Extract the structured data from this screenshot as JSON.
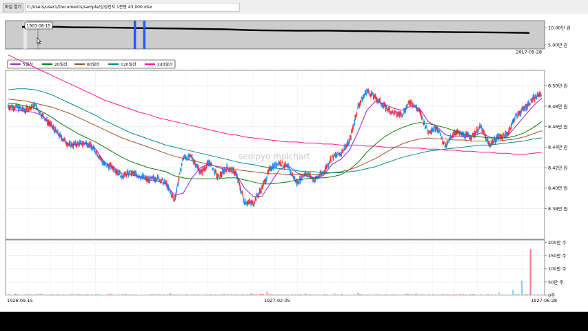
{
  "toolbar": {
    "open_label": "파일 열기",
    "file_path": "C:/Users/user1/Documents/sample/삼성전자 1분봉 43,000.xlsx"
  },
  "watermark": "seolpyo mplchart",
  "colors": {
    "up": "#fe3032",
    "down": "#1e90ff",
    "ma5": "#9932cc",
    "ma20": "#008000",
    "ma60": "#a0522d",
    "ma120": "#008b8b",
    "ma240": "#ff1493",
    "volume_up": "#f08080",
    "volume_down": "#87cefa",
    "slider_selection": "#1e5bff"
  },
  "chart_data": [
    {
      "type": "line",
      "name": "overview-slider",
      "y_ticks": [
        {
          "value": 100000,
          "label": "10.00만 원"
        },
        {
          "value": 50000,
          "label": "5.00만 원"
        }
      ],
      "ylim": [
        25000,
        125000
      ],
      "x_end_label": "2017-09-28",
      "tooltip": "1903-08-15",
      "path": [
        [
          0,
          103000
        ],
        [
          5,
          104000
        ],
        [
          10,
          101500
        ],
        [
          15,
          101000
        ],
        [
          20,
          100000
        ],
        [
          25,
          98500
        ],
        [
          30,
          97500
        ],
        [
          35,
          96000
        ],
        [
          40,
          94500
        ],
        [
          45,
          91500
        ],
        [
          48,
          90500
        ],
        [
          55,
          89500
        ],
        [
          60,
          90000
        ],
        [
          65,
          88500
        ],
        [
          70,
          88000
        ],
        [
          75,
          86500
        ],
        [
          80,
          85500
        ],
        [
          85,
          84500
        ],
        [
          90,
          84000
        ],
        [
          95,
          83000
        ],
        [
          100,
          81500
        ]
      ],
      "selection": [
        22,
        24
      ]
    },
    {
      "type": "candlestick",
      "name": "price-chart",
      "ylim": [
        83500,
        85150
      ],
      "y_ticks": [
        {
          "value": 85000,
          "label": "8.50만 원"
        },
        {
          "value": 84800,
          "label": "8.48만 원"
        },
        {
          "value": 84600,
          "label": "8.46만 원"
        },
        {
          "value": 84400,
          "label": "8.44만 원"
        },
        {
          "value": 84200,
          "label": "8.42만 원"
        },
        {
          "value": 84000,
          "label": "8.40만 원"
        },
        {
          "value": 83800,
          "label": "8.38만 원"
        }
      ],
      "x_labels": [
        "1926-09-15",
        "1927-02-05",
        "1927-06-28"
      ],
      "legend": [
        "5일선",
        "20일선",
        "60일선",
        "120일선",
        "240일선"
      ],
      "closes": [
        84800,
        84790,
        84760,
        84810,
        84700,
        84600,
        84500,
        84420,
        84430,
        84440,
        84360,
        84230,
        84200,
        84120,
        84150,
        84120,
        84080,
        84100,
        84050,
        83880,
        84300,
        84300,
        84150,
        84250,
        84100,
        84200,
        84150,
        83870,
        83850,
        84000,
        84200,
        84250,
        84200,
        84050,
        84150,
        84080,
        84150,
        84300,
        84340,
        84450,
        84800,
        84950,
        84880,
        84800,
        84730,
        84720,
        84850,
        84750,
        84550,
        84600,
        84400,
        84550,
        84520,
        84500,
        84600,
        84420,
        84500,
        84520,
        84700,
        84780,
        84870,
        84930
      ],
      "ma_series": [
        {
          "name": "ma5",
          "values": [
            84770,
            84760,
            84750,
            84740,
            84700,
            84600,
            84500,
            84420,
            84430,
            84440,
            84380,
            84250,
            84210,
            84140,
            84130,
            84110,
            84080,
            84070,
            84040,
            83930,
            83950,
            84100,
            84200,
            84240,
            84200,
            84180,
            84140,
            84000,
            83920,
            83920,
            84050,
            84180,
            84220,
            84150,
            84120,
            84100,
            84120,
            84230,
            84280,
            84370,
            84550,
            84760,
            84850,
            84820,
            84780,
            84760,
            84800,
            84780,
            84650,
            84600,
            84520,
            84500,
            84500,
            84500,
            84540,
            84500,
            84480,
            84500,
            84600,
            84700,
            84800,
            84880
          ]
        },
        {
          "name": "ma20",
          "values": [
            84830,
            84820,
            84800,
            84780,
            84740,
            84690,
            84630,
            84580,
            84530,
            84490,
            84450,
            84400,
            84350,
            84300,
            84260,
            84230,
            84200,
            84180,
            84160,
            84120,
            84100,
            84090,
            84090,
            84090,
            84090,
            84100,
            84100,
            84080,
            84060,
            84040,
            84040,
            84050,
            84060,
            84080,
            84090,
            84100,
            84100,
            84110,
            84130,
            84180,
            84250,
            84350,
            84430,
            84500,
            84550,
            84590,
            84620,
            84640,
            84630,
            84610,
            84590,
            84560,
            84530,
            84510,
            84500,
            84490,
            84490,
            84490,
            84510,
            84540,
            84590,
            84650
          ]
        },
        {
          "name": "ma60",
          "values": [
            84870,
            84860,
            84850,
            84830,
            84810,
            84790,
            84760,
            84730,
            84690,
            84650,
            84610,
            84570,
            84530,
            84490,
            84460,
            84430,
            84400,
            84370,
            84340,
            84310,
            84290,
            84270,
            84250,
            84230,
            84210,
            84200,
            84180,
            84170,
            84160,
            84150,
            84140,
            84140,
            84130,
            84130,
            84130,
            84130,
            84140,
            84150,
            84160,
            84180,
            84210,
            84250,
            84290,
            84340,
            84390,
            84430,
            84460,
            84480,
            84490,
            84480,
            84480,
            84470,
            84470,
            84460,
            84460,
            84460,
            84460,
            84470,
            84480,
            84500,
            84530,
            84560
          ]
        },
        {
          "name": "ma120",
          "values": [
            84960,
            84970,
            84970,
            84960,
            84940,
            84910,
            84870,
            84830,
            84790,
            84750,
            84710,
            84660,
            84620,
            84580,
            84540,
            84510,
            84480,
            84450,
            84420,
            84400,
            84380,
            84360,
            84340,
            84320,
            84300,
            84280,
            84260,
            84240,
            84230,
            84210,
            84200,
            84190,
            84180,
            84170,
            84160,
            84160,
            84150,
            84150,
            84150,
            84160,
            84170,
            84190,
            84210,
            84240,
            84270,
            84300,
            84320,
            84340,
            84360,
            84370,
            84380,
            84390,
            84400,
            84410,
            84420,
            84420,
            84430,
            84440,
            84450,
            84460,
            84480,
            84490
          ]
        },
        {
          "name": "ma240",
          "values": [
            85300,
            85260,
            85220,
            85180,
            85140,
            85100,
            85060,
            85020,
            84980,
            84940,
            84900,
            84860,
            84830,
            84800,
            84770,
            84740,
            84720,
            84690,
            84670,
            84650,
            84630,
            84610,
            84590,
            84570,
            84550,
            84530,
            84520,
            84500,
            84490,
            84480,
            84470,
            84460,
            84450,
            84450,
            84440,
            84440,
            84430,
            84430,
            84420,
            84420,
            84420,
            84410,
            84410,
            84400,
            84400,
            84400,
            84390,
            84390,
            84380,
            84380,
            84370,
            84370,
            84360,
            84360,
            84350,
            84350,
            84340,
            84340,
            84330,
            84330,
            84340,
            84350
          ]
        }
      ]
    },
    {
      "type": "bar",
      "name": "volume-chart",
      "ylim": [
        0,
        210
      ],
      "y_ticks": [
        {
          "value": 200,
          "label": "200만 주"
        },
        {
          "value": 150,
          "label": "150만 주"
        },
        {
          "value": 100,
          "label": "100만 주"
        },
        {
          "value": 50,
          "label": "50만 주"
        },
        {
          "value": 0,
          "label": "0주"
        }
      ],
      "spikes": [
        {
          "index": 59,
          "value": 175
        },
        {
          "index": 58,
          "value": 55
        },
        {
          "index": 57,
          "value": 20
        }
      ]
    }
  ]
}
